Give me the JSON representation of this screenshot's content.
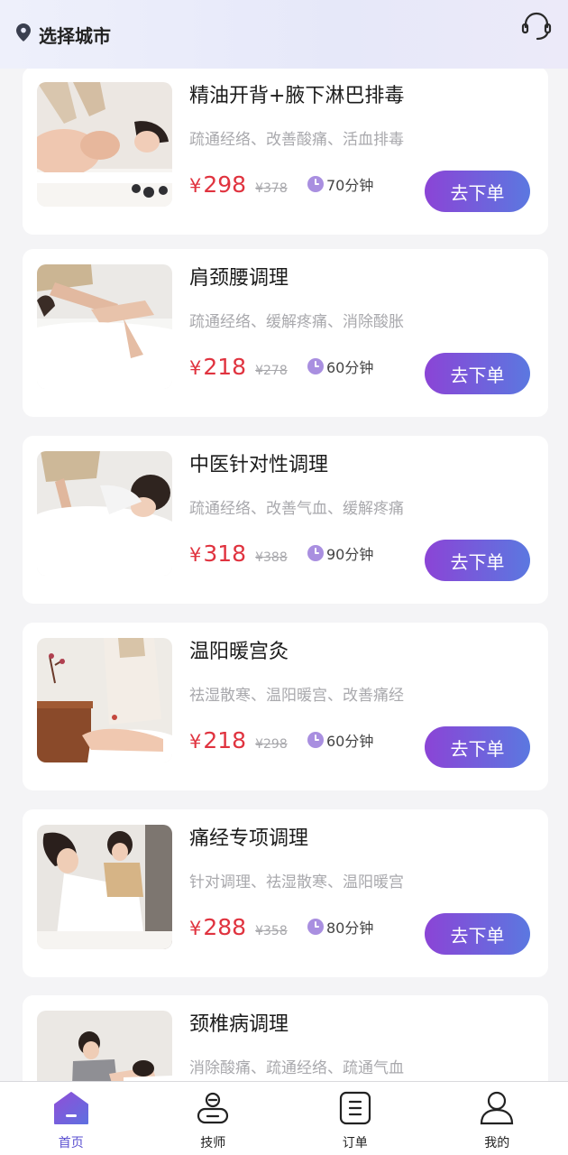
{
  "header": {
    "city_label": "选择城市",
    "location_icon": "map-pin-icon",
    "service_icon": "headset-icon"
  },
  "colors": {
    "price": "#e0333f",
    "button_gradient_start": "#8b44d6",
    "button_gradient_end": "#5b78e0",
    "active_tab": "#5a4fd0"
  },
  "services": [
    {
      "title": "精油开背+腋下淋巴排毒",
      "tags": "疏通经络、改善酸痛、活血排毒",
      "currency": "¥",
      "price": "298",
      "original_price": "¥378",
      "duration": "70分钟",
      "button_label": "去下单"
    },
    {
      "title": "肩颈腰调理",
      "tags": "疏通经络、缓解疼痛、消除酸胀",
      "currency": "¥",
      "price": "218",
      "original_price": "¥278",
      "duration": "60分钟",
      "button_label": "去下单"
    },
    {
      "title": "中医针对性调理",
      "tags": "疏通经络、改善气血、缓解疼痛",
      "currency": "¥",
      "price": "318",
      "original_price": "¥388",
      "duration": "90分钟",
      "button_label": "去下单"
    },
    {
      "title": "温阳暖宫灸",
      "tags": "祛湿散寒、温阳暖宫、改善痛经",
      "currency": "¥",
      "price": "218",
      "original_price": "¥298",
      "duration": "60分钟",
      "button_label": "去下单"
    },
    {
      "title": "痛经专项调理",
      "tags": "针对调理、祛湿散寒、温阳暖宫",
      "currency": "¥",
      "price": "288",
      "original_price": "¥358",
      "duration": "80分钟",
      "button_label": "去下单"
    },
    {
      "title": "颈椎病调理",
      "tags": "消除酸痛、疏通经络、疏通气血"
    }
  ],
  "tabbar": [
    {
      "label": "首页",
      "icon": "home-icon",
      "active": true
    },
    {
      "label": "技师",
      "icon": "technician-icon",
      "active": false
    },
    {
      "label": "订单",
      "icon": "order-icon",
      "active": false
    },
    {
      "label": "我的",
      "icon": "user-icon",
      "active": false
    }
  ]
}
